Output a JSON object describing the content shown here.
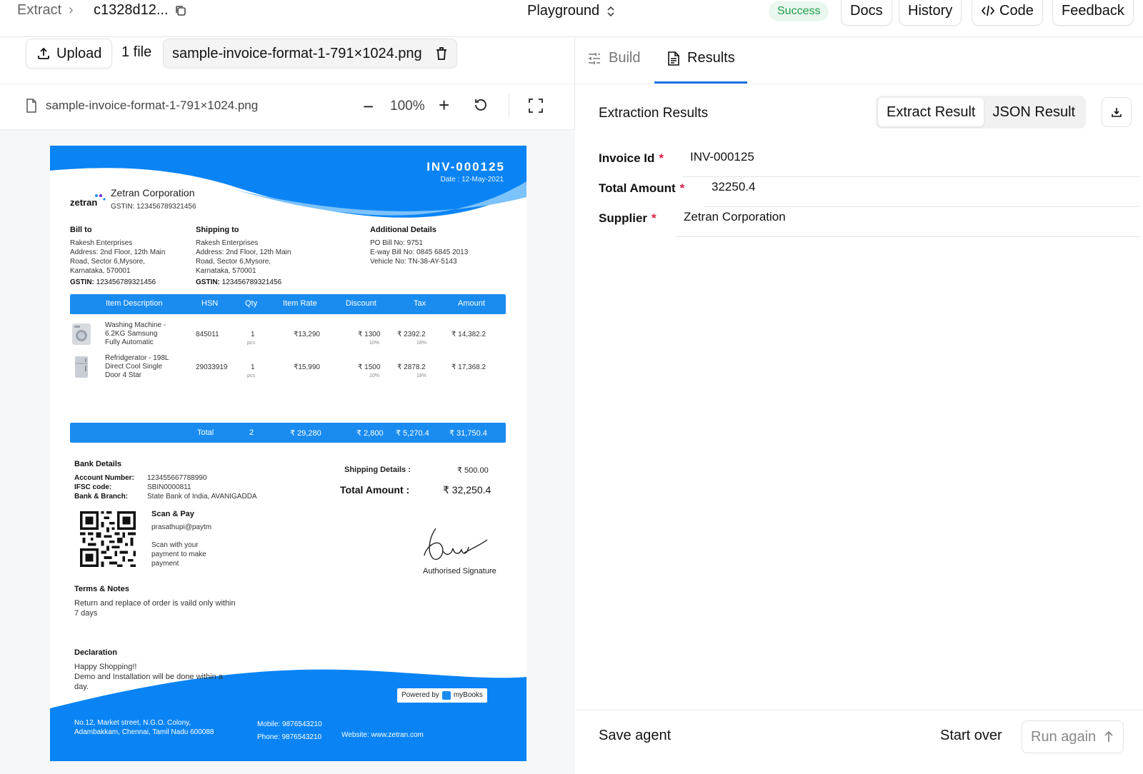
{
  "header": {
    "breadcrumb_root": "Extract",
    "breadcrumb_id": "c1328d12...",
    "mode": "Playground",
    "status": "Success",
    "buttons": {
      "docs": "Docs",
      "history": "History",
      "code": "Code",
      "feedback": "Feedback"
    }
  },
  "upload": {
    "button": "Upload",
    "file_count": "1 file",
    "file_name": "sample-invoice-format-1-791×1024.png"
  },
  "viewer": {
    "file_name": "sample-invoice-format-1-791×1024.png",
    "zoom_out": "−",
    "zoom": "100%",
    "zoom_in": "+"
  },
  "invoice": {
    "number": "INV-000125",
    "date": "Date : 12-May-2021",
    "logo": "zetran",
    "company": "Zetran Corporation",
    "company_gstin": "GSTIN: 123456789321456",
    "bill_to": {
      "heading": "Bill to",
      "name": "Rakesh Enterprises",
      "address1": "Address: 2nd Floor, 12th Main",
      "address2": "Road, Sector 6,Mysore,",
      "address3": "Karnataka, 570001",
      "gstin_label": "GSTIN:",
      "gstin": " 123456789321456"
    },
    "ship_to": {
      "heading": "Shipping to",
      "name": "Rakesh Enterprises",
      "address1": "Address: 2nd Floor, 12th Main",
      "address2": "Road, Sector 6,Mysore,",
      "address3": "Karnataka, 570001",
      "gstin_label": "GSTIN:",
      "gstin": " 123456789321456"
    },
    "additional": {
      "heading": "Additional Details",
      "po": "PO Bill No: 9751",
      "eway": "E-way Bill No: 0845 6845 2013",
      "vehicle": "Vehicle No: TN-38-AY-5143"
    },
    "columns": [
      "Item Description",
      "HSN",
      "Qty",
      "Item Rate",
      "Discount",
      "Tax",
      "Amount"
    ],
    "items": [
      {
        "desc1": "Washing Machine -",
        "desc2": "6.2KG Samsung",
        "desc3": "Fully Automatic",
        "hsn": "845011",
        "qty": "1",
        "unit": "pcs",
        "rate": "₹13,290",
        "discount": "₹ 1300",
        "discount_pct": "10%",
        "tax": "₹ 2392.2",
        "tax_pct": "18%",
        "amount": "₹ 14,382.2"
      },
      {
        "desc1": "Refridgerator - 198L",
        "desc2": "Direct Cool Single",
        "desc3": "Door 4 Star",
        "hsn": "29033919",
        "qty": "1",
        "unit": "pcs",
        "rate": "₹15,990",
        "discount": "₹ 1500",
        "discount_pct": "10%",
        "tax": "₹ 2878.2",
        "tax_pct": "18%",
        "amount": "₹ 17,368.2"
      }
    ],
    "totals": {
      "label": "Total",
      "qty": "2",
      "rate": "₹ 29,280",
      "discount": "₹ 2,800",
      "tax": "₹ 5,270.4",
      "amount": "₹ 31,750.4"
    },
    "bank": {
      "heading": "Bank Details",
      "acc_label": "Account Number:",
      "acc": "123455667788990",
      "ifsc_label": "IFSC code:",
      "ifsc": "SBIN0000811",
      "branch_label": "Bank & Branch:",
      "branch": "State Bank of India, AVANIGADDA"
    },
    "shipping_label": "Shipping Details :",
    "shipping_value": "₹ 500.00",
    "total_label": "Total Amount :",
    "total_value": "₹ 32,250.4",
    "scan": {
      "heading": "Scan & Pay",
      "upi": "prasathupi@paytm",
      "line1": "Scan with your",
      "line2": "payment to make",
      "line3": "payment"
    },
    "signature_label": "Authorised Signature",
    "terms": {
      "heading": "Terms & Notes",
      "text": "Return and replace of order is vaild only within 7 days"
    },
    "declaration": {
      "heading": "Declaration",
      "line1": "Happy Shopping!!",
      "line2": "Demo and Installation will be done within a day."
    },
    "powered_by": "Powered by",
    "powered_brand": "myBooks",
    "footer": {
      "address1": "No.12, Market street, N.G.O. Colony,",
      "address2": "Adambakkam, Chennai, Tamil Nadu 600088",
      "mobile": "Mobile: 9876543210",
      "phone": "Phone: 9876543210",
      "website": "Website: www.zetran.com"
    }
  },
  "results_panel": {
    "tabs": {
      "build": "Build",
      "results": "Results"
    },
    "title": "Extraction Results",
    "toggle": {
      "extract": "Extract Result",
      "json": "JSON Result"
    },
    "fields": [
      {
        "label": "Invoice Id",
        "value": "INV-000125"
      },
      {
        "label": "Total Amount",
        "value": "32250.4"
      },
      {
        "label": "Supplier",
        "value": "Zetran Corporation"
      }
    ],
    "required_marker": "*",
    "footer": {
      "save": "Save agent",
      "start_over": "Start over",
      "run_again": "Run again"
    }
  },
  "colors": {
    "accent": "#1a73e8",
    "invoice_blue": "#1a8cf0",
    "success": "#1e9e4a",
    "required": "#e11d48"
  }
}
